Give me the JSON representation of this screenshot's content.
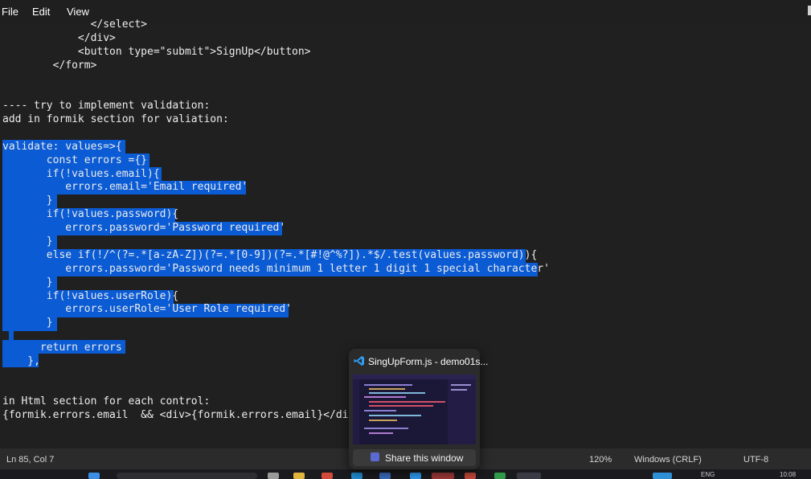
{
  "menu": {
    "file": "File",
    "edit": "Edit",
    "view": "View"
  },
  "code_lines": [
    "              </select>",
    "            </div>",
    "            <button type=\"submit\">SignUp</button>",
    "        </form>",
    "",
    "",
    "---- try to implement validation:",
    "add in formik section for valiation:",
    "",
    "validate: values=>{",
    "       const errors ={}",
    "       if(!values.email){",
    "          errors.email='Email required'",
    "       }",
    "       if(!values.password){",
    "          errors.password='Password required'",
    "       }",
    "       else if(!/^(?=.*[a-zA-Z])(?=.*[0-9])(?=.*[#!@^%?]).*$/.test(values.password)){",
    "          errors.password='Password needs minimum 1 letter 1 digit 1 special character'",
    "       }",
    "       if(!values.userRole){",
    "          errors.userRole='User Role required'",
    "       }",
    "",
    "      return errors",
    "    },",
    "",
    "",
    "in Html section for each control:",
    "{formik.errors.email  && <div>{formik.errors.email}</div>}"
  ],
  "status": {
    "position": "Ln 85, Col 7",
    "zoom": "120%",
    "line_ending": "Windows (CRLF)",
    "encoding": "UTF-8"
  },
  "preview": {
    "title": "SingUpForm.js - demo01s...",
    "share_label": "Share this window",
    "app_icon": "vscode-icon"
  },
  "taskbar": {
    "lang": "ENG",
    "time": "10:08"
  },
  "colors": {
    "editor_bg": "#202020",
    "selection": "#0a5bd4",
    "statusbar": "#2b2b2b",
    "vscode_blue": "#2f9df4"
  }
}
